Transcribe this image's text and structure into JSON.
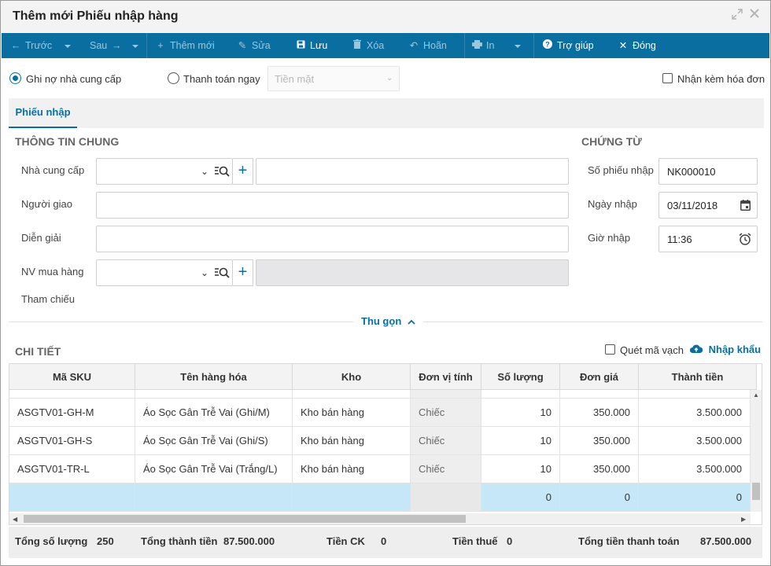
{
  "window": {
    "title": "Thêm mới Phiếu nhập hàng"
  },
  "toolbar": {
    "prev": "Trước",
    "next": "Sau",
    "add": "Thêm mới",
    "edit": "Sửa",
    "save": "Lưu",
    "delete": "Xóa",
    "undo": "Hoãn",
    "print": "In",
    "help": "Trợ giúp",
    "close": "Đóng"
  },
  "payment": {
    "debt_label": "Ghi nợ nhà cung cấp",
    "pay_now_label": "Thanh toán ngay",
    "method_placeholder": "Tiền mặt",
    "with_invoice_label": "Nhận kèm hóa đơn",
    "selected": "debt"
  },
  "tabs": [
    {
      "label": "Phiếu nhập"
    }
  ],
  "general": {
    "heading": "THÔNG TIN CHUNG",
    "supplier_label": "Nhà cung cấp",
    "deliverer_label": "Người giao",
    "description_label": "Diễn giải",
    "buyer_label": "NV mua hàng",
    "reference_label": "Tham chiếu"
  },
  "voucher": {
    "heading": "CHỨNG TỪ",
    "number_label": "Số phiếu nhập",
    "number_value": "NK000010",
    "date_label": "Ngày nhập",
    "date_value": "03/11/2018",
    "time_label": "Giờ nhập",
    "time_value": "11:36"
  },
  "collapse_label": "Thu gọn",
  "detail": {
    "heading": "CHI TIẾT",
    "scan_label": "Quét mã vạch",
    "import_label": "Nhập khẩu",
    "columns": [
      "Mã SKU",
      "Tên hàng hóa",
      "Kho",
      "Đơn vị tính",
      "Số lượng",
      "Đơn giá",
      "Thành tiền"
    ],
    "rows": [
      {
        "sku": "ASGTV01-GH-M",
        "name": "Áo Sọc Gân Trễ Vai (Ghi/M)",
        "warehouse": "Kho bán hàng",
        "unit": "Chiếc",
        "qty": "10",
        "price": "350.000",
        "amount": "3.500.000"
      },
      {
        "sku": "ASGTV01-GH-S",
        "name": "Áo Sọc Gân Trễ Vai (Ghi/S)",
        "warehouse": "Kho bán hàng",
        "unit": "Chiếc",
        "qty": "10",
        "price": "350.000",
        "amount": "3.500.000"
      },
      {
        "sku": "ASGTV01-TR-L",
        "name": "Áo Sọc Gân Trễ Vai (Trắng/L)",
        "warehouse": "Kho bán hàng",
        "unit": "Chiếc",
        "qty": "10",
        "price": "350.000",
        "amount": "3.500.000"
      }
    ],
    "new_row": {
      "qty": "0",
      "price": "0",
      "amount": "0"
    }
  },
  "totals": {
    "qty_label": "Tổng số lượng",
    "qty_value": "250",
    "amount_label": "Tổng thành tiền",
    "amount_value": "87.500.000",
    "discount_label": "Tiền CK",
    "discount_value": "0",
    "tax_label": "Tiền thuế",
    "tax_value": "0",
    "payment_label": "Tổng tiền thanh toán",
    "payment_value": "87.500.000"
  },
  "colors": {
    "brand": "#0b6ea1",
    "selected_row": "#c6e7f7"
  },
  "icons": [
    "maximize-icon",
    "close-icon",
    "arrow-left-icon",
    "arrow-right-icon",
    "plus-icon",
    "pencil-icon",
    "save-icon",
    "trash-icon",
    "undo-icon",
    "printer-icon",
    "help-icon",
    "x-icon",
    "search-list-icon",
    "calendar-icon",
    "clock-icon",
    "cloud-upload-icon",
    "chevron-up-icon"
  ]
}
